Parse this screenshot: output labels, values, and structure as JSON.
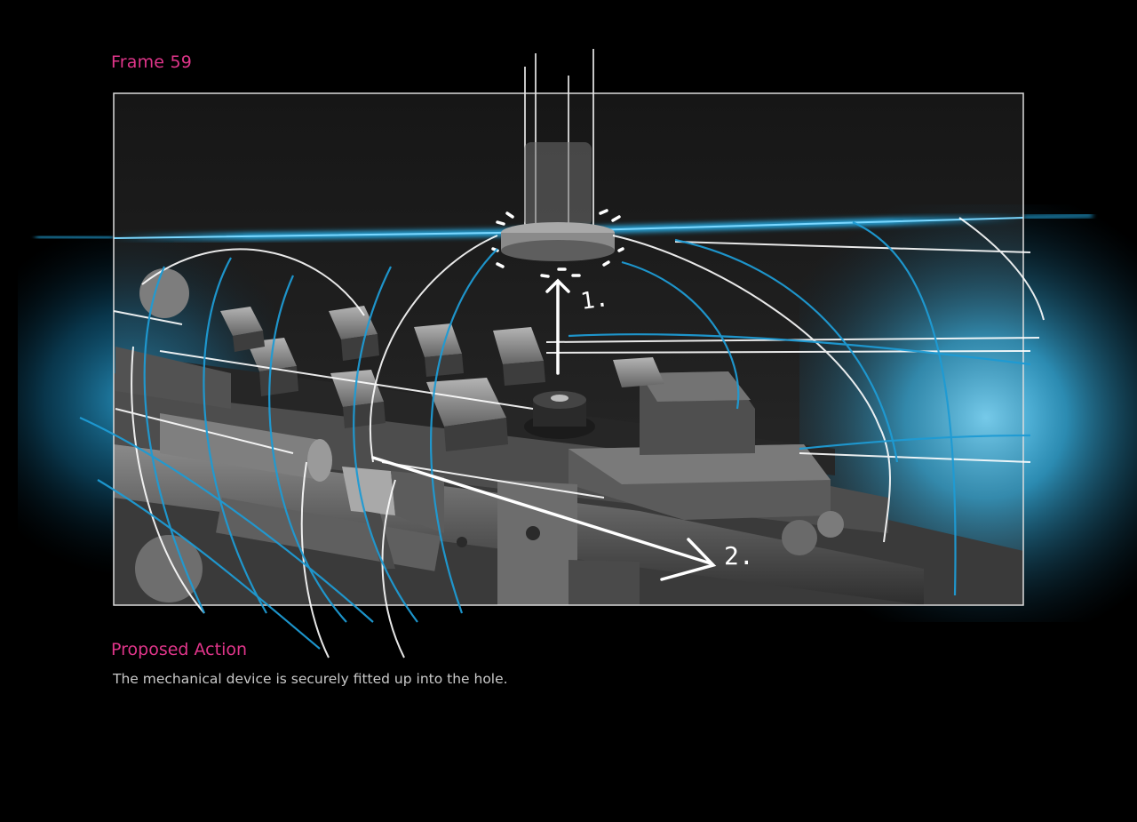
{
  "frame": {
    "title": "Frame 59"
  },
  "illustration": {
    "annotations": {
      "step_1": "1.",
      "step_2": "2."
    },
    "colors": {
      "accent_text": "#e0358a",
      "glow": "#20b4ff",
      "sketch_lines": "#ffffff"
    }
  },
  "proposal": {
    "heading": "Proposed Action",
    "description": "The mechanical device is securely fitted up into the hole."
  }
}
